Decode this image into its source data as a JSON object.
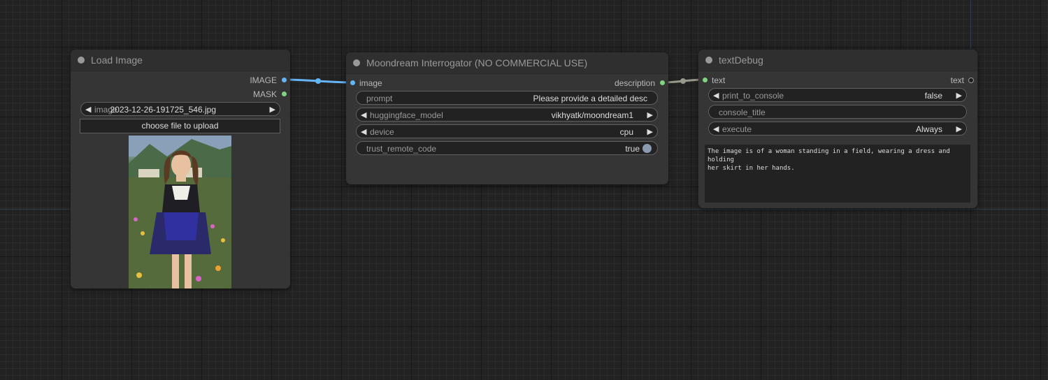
{
  "colors": {
    "image_link": "#64b5f6",
    "string_link": "#9a9a8c",
    "mask_slot": "#7fd47f"
  },
  "load_image": {
    "title": "Load Image",
    "outputs": [
      "IMAGE",
      "MASK"
    ],
    "image_widget": {
      "name": "image",
      "value": "2023-12-26-191725_546.jpg"
    },
    "upload_label": "choose file to upload",
    "preview_icon": "woman-in-flower-field-image"
  },
  "moondream": {
    "title": "Moondream Interrogator (NO COMMERCIAL USE)",
    "input": "image",
    "output": "description",
    "widgets": {
      "prompt": {
        "name": "prompt",
        "value": "Please provide a detailed desc"
      },
      "model": {
        "name": "huggingface_model",
        "value": "vikhyatk/moondream1"
      },
      "device": {
        "name": "device",
        "value": "cpu"
      },
      "trust": {
        "name": "trust_remote_code",
        "value": "true"
      }
    }
  },
  "text_debug": {
    "title": "textDebug",
    "input": "text",
    "output": "text",
    "widgets": {
      "print": {
        "name": "print_to_console",
        "value": "false"
      },
      "console_title": {
        "name": "console_title"
      },
      "execute": {
        "name": "execute",
        "value": "Always"
      }
    },
    "output_text": "The image is of a woman standing in a field, wearing a dress and holding\nher skirt in her hands."
  }
}
